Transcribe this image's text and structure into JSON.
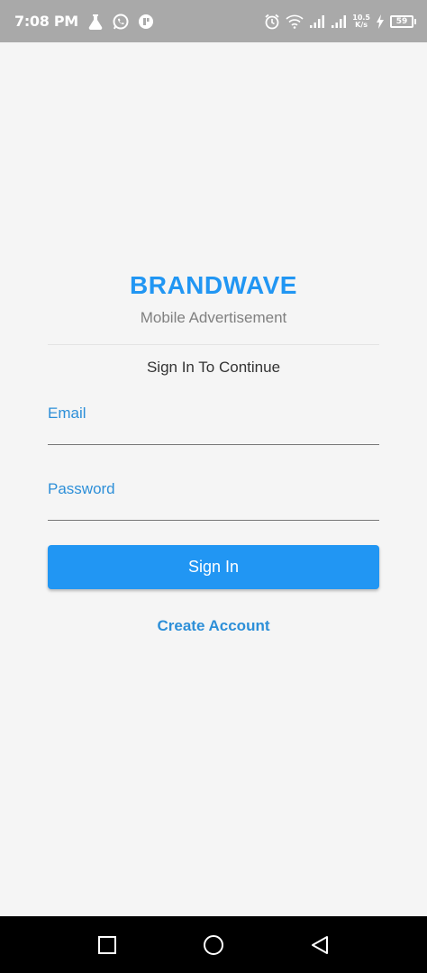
{
  "status_bar": {
    "time": "7:08 PM",
    "left_icons": [
      "flask-icon",
      "whatsapp-icon",
      "app-notification-icon"
    ],
    "net_speed_value": "10.5",
    "net_speed_unit": "K/s",
    "battery_level": "59",
    "right_icons": [
      "alarm-icon",
      "wifi-icon",
      "signal-icon",
      "signal-icon",
      "charging-icon",
      "battery-icon"
    ]
  },
  "brand": {
    "title": "BRANDWAVE",
    "subtitle": "Mobile Advertisement"
  },
  "form": {
    "heading": "Sign In To Continue",
    "email_label": "Email",
    "email_value": "",
    "password_label": "Password",
    "password_value": "",
    "submit_label": "Sign In",
    "create_account_label": "Create Account"
  },
  "nav_bar": {
    "buttons": [
      "recent-apps-icon",
      "home-icon",
      "back-icon"
    ]
  },
  "colors": {
    "accent": "#2196f3",
    "status_bar": "#a9a9a9",
    "background": "#f5f5f5"
  }
}
